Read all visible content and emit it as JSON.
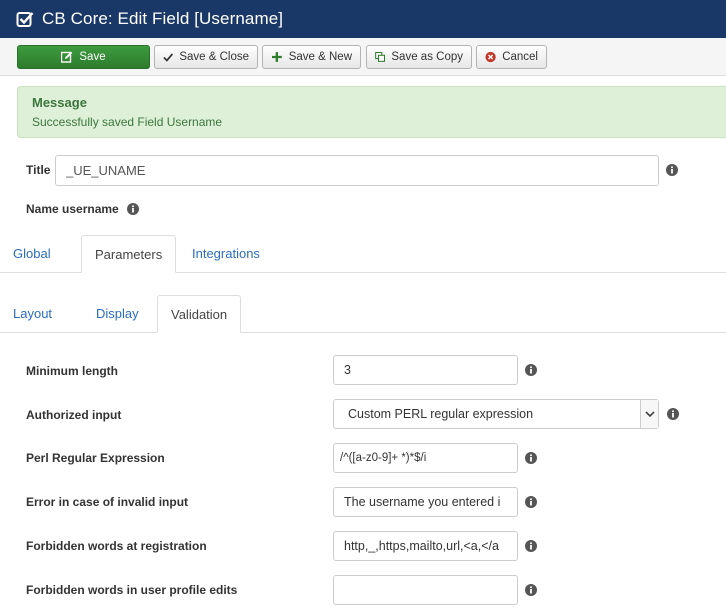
{
  "header": {
    "title": "CB Core: Edit Field [Username]"
  },
  "toolbar": {
    "save": "Save",
    "save_close": "Save & Close",
    "save_new": "Save & New",
    "save_copy": "Save as Copy",
    "cancel": "Cancel"
  },
  "message": {
    "heading": "Message",
    "text": "Successfully saved Field Username"
  },
  "field": {
    "title_label": "Title",
    "title_value": "_UE_UNAME",
    "name_label": "Name username"
  },
  "main_tabs": [
    "Global",
    "Parameters",
    "Integrations"
  ],
  "main_tabs_active": "Parameters",
  "sub_tabs": [
    "Layout",
    "Display",
    "Validation"
  ],
  "sub_tabs_active": "Validation",
  "validation": {
    "min_length_label": "Minimum length",
    "min_length_value": "3",
    "authorized_label": "Authorized input",
    "authorized_value": "Custom PERL regular expression",
    "perl_label": "Perl Regular Expression",
    "perl_value": "/^([a-z0-9]+ *)*$/i",
    "error_label": "Error in case of invalid input",
    "error_value": "The username you entered i",
    "forbidden_reg_label": "Forbidden words at registration",
    "forbidden_reg_value": "http,_,https,mailto,url,<a,</a",
    "forbidden_edit_label": "Forbidden words in user profile edits",
    "forbidden_edit_value": ""
  },
  "colors": {
    "header_bg": "#1a3867",
    "success_green": "#2d7c2d",
    "message_bg": "#dff0d8",
    "link_blue": "#2a6ebb"
  },
  "icons": {
    "header": "checkbox-edit-icon",
    "save": "edit-icon",
    "save_close": "checkmark-icon",
    "save_new": "plus-icon",
    "save_copy": "copy-icon",
    "cancel": "cancel-circle-icon",
    "info": "info-icon",
    "select_caret": "chevron-down-icon"
  }
}
